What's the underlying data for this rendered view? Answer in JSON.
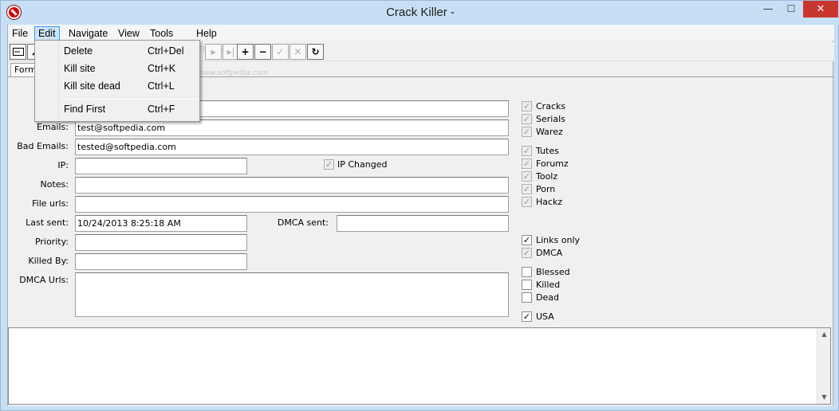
{
  "window": {
    "title": "Crack Killer -",
    "controls": {
      "minimize": "—",
      "maximize": "☐",
      "close": "✕"
    }
  },
  "menubar": [
    "File",
    "Edit",
    "Navigate",
    "View",
    "Tools",
    "Help"
  ],
  "edit_menu": [
    {
      "label": "Delete",
      "shortcut": "Ctrl+Del"
    },
    {
      "label": "Kill site",
      "shortcut": "Ctrl+K"
    },
    {
      "label": "Kill site dead",
      "shortcut": "Ctrl+L"
    },
    {
      "label": "Find First",
      "shortcut": "Ctrl+F"
    }
  ],
  "toolbar": {
    "icons": [
      "form-icon",
      "wrench-icon",
      "nav-first-icon",
      "nav-prior-icon",
      "nav-next-icon",
      "nav-last-icon",
      "insert-icon",
      "delete-icon",
      "post-icon",
      "cancel-icon",
      "refresh-icon"
    ],
    "glyphs": {
      "insert": "+",
      "delete": "−",
      "post": "✓",
      "cancel": "✕",
      "refresh": "↻",
      "next": "▸",
      "last": "▸|"
    }
  },
  "watermark": "SOFTPEDIA",
  "watermark_url": "www.softpedia.com",
  "tabs": [
    "Form"
  ],
  "form": {
    "emails_label": "Emails:",
    "emails_value": "test@softpedia.com",
    "bad_emails_label": "Bad Emails:",
    "bad_emails_value": "tested@softpedia.com",
    "ip_label": "IP:",
    "ip_value": "",
    "ip_changed_label": "IP Changed",
    "notes_label": "Notes:",
    "notes_value": "",
    "file_urls_label": "File urls:",
    "file_urls_value": "",
    "last_sent_label": "Last sent:",
    "last_sent_value": "10/24/2013 8:25:18 AM",
    "dmca_sent_label": "DMCA sent:",
    "dmca_sent_value": "",
    "priority_label": "Priority:",
    "priority_value": "",
    "killed_by_label": "Killed By:",
    "killed_by_value": "",
    "dmca_urls_label": "DMCA Urls:",
    "dmca_urls_value": ""
  },
  "checkboxes": [
    {
      "label": "Cracks",
      "checked": true,
      "enabled": false
    },
    {
      "label": "Serials",
      "checked": true,
      "enabled": false
    },
    {
      "label": "Warez",
      "checked": true,
      "enabled": false
    },
    {
      "label": "Tutes",
      "checked": true,
      "enabled": false
    },
    {
      "label": "Forumz",
      "checked": true,
      "enabled": false
    },
    {
      "label": "Toolz",
      "checked": true,
      "enabled": false
    },
    {
      "label": "Porn",
      "checked": true,
      "enabled": false
    },
    {
      "label": "Hackz",
      "checked": true,
      "enabled": false
    },
    {
      "label": "Links only",
      "checked": true,
      "enabled": true
    },
    {
      "label": "DMCA",
      "checked": true,
      "enabled": false
    },
    {
      "label": "Blessed",
      "checked": false,
      "enabled": true
    },
    {
      "label": "Killed",
      "checked": false,
      "enabled": true
    },
    {
      "label": "Dead",
      "checked": false,
      "enabled": true
    },
    {
      "label": "USA",
      "checked": true,
      "enabled": true
    }
  ],
  "check_glyph": "✓",
  "log": {
    "value": "",
    "scroll_up": "▲",
    "scroll_down": "▼"
  }
}
